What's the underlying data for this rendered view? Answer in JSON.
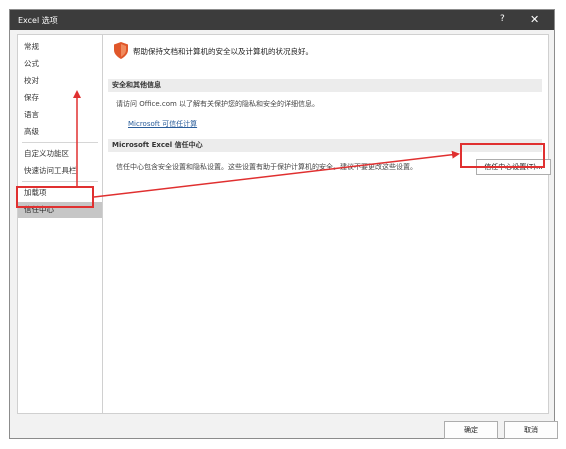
{
  "window": {
    "title": "Excel 选项",
    "help": "?",
    "close": "✕"
  },
  "sidebar": {
    "items": [
      {
        "label": "常规"
      },
      {
        "label": "公式"
      },
      {
        "label": "校对"
      },
      {
        "label": "保存"
      },
      {
        "label": "语言"
      },
      {
        "label": "高级"
      },
      {
        "label": "自定义功能区"
      },
      {
        "label": "快速访问工具栏"
      },
      {
        "label": "加载项"
      },
      {
        "label": "信任中心"
      }
    ],
    "selected": "信任中心"
  },
  "main": {
    "intro": "帮助保持文档和计算机的安全以及计算机的状况良好。",
    "security_section": {
      "header": "安全和其他信息",
      "text": "请访问 Office.com 以了解有关保护您的隐私和安全的详细信息。",
      "link": "Microsoft 可信任计算"
    },
    "trust_section": {
      "header": "Microsoft Excel 信任中心",
      "text": "信任中心包含安全设置和隐私设置。这些设置有助于保护计算机的安全。建议不要更改这些设置。",
      "button": "信任中心设置(T)..."
    }
  },
  "footer": {
    "ok": "确定",
    "cancel": "取消"
  },
  "colors": {
    "titlebar": "#3c3c3c",
    "shield": "#e0572a",
    "highlight": "#e03030",
    "link": "#2a5d9a"
  },
  "icons": {
    "shield": "shield-icon",
    "close": "close-icon",
    "help": "help-icon"
  }
}
